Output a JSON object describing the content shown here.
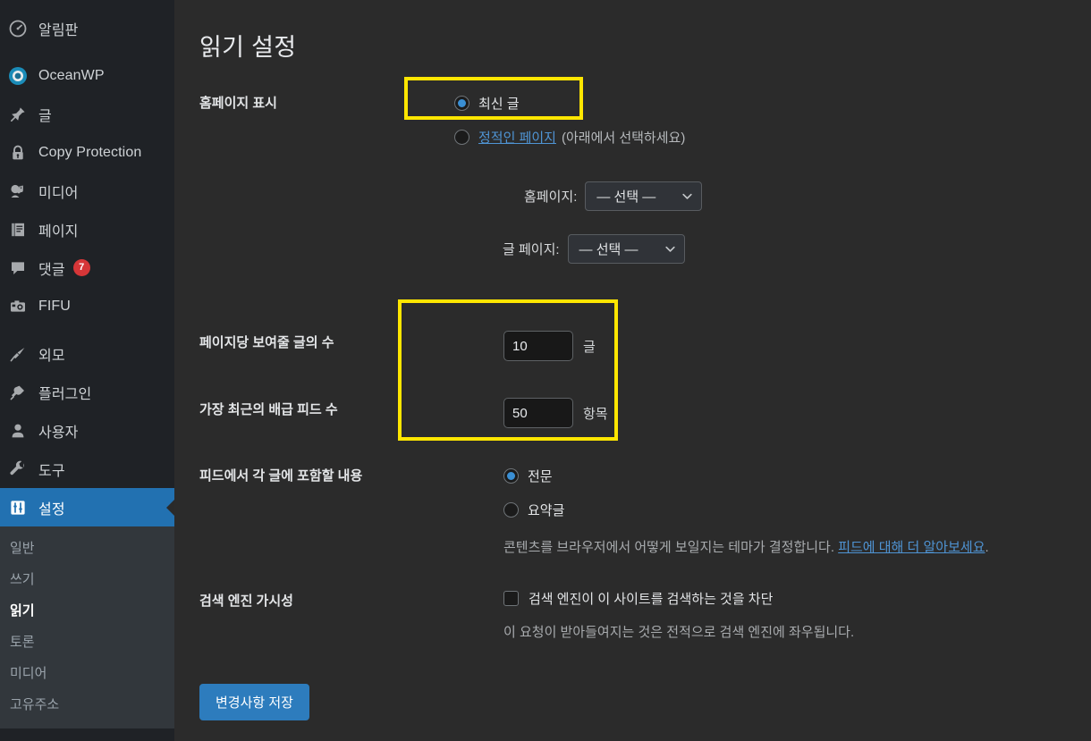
{
  "sidebar": {
    "items": [
      {
        "label": "알림판",
        "icon": "dashboard-icon",
        "active": false,
        "badge": null
      },
      {
        "label": "OceanWP",
        "icon": "oceanwp-icon",
        "active": false,
        "badge": null
      },
      {
        "label": "글",
        "icon": "pin-icon",
        "active": false,
        "badge": null
      },
      {
        "label": "Copy Protection",
        "icon": "lock-icon",
        "active": false,
        "badge": null
      },
      {
        "label": "미디어",
        "icon": "media-icon",
        "active": false,
        "badge": null
      },
      {
        "label": "페이지",
        "icon": "page-icon",
        "active": false,
        "badge": null
      },
      {
        "label": "댓글",
        "icon": "comment-icon",
        "active": false,
        "badge": "7"
      },
      {
        "label": "FIFU",
        "icon": "camera-icon",
        "active": false,
        "badge": null
      },
      {
        "label": "외모",
        "icon": "brush-icon",
        "active": false,
        "badge": null
      },
      {
        "label": "플러그인",
        "icon": "plugin-icon",
        "active": false,
        "badge": null
      },
      {
        "label": "사용자",
        "icon": "user-icon",
        "active": false,
        "badge": null
      },
      {
        "label": "도구",
        "icon": "wrench-icon",
        "active": false,
        "badge": null
      },
      {
        "label": "설정",
        "icon": "settings-icon",
        "active": true,
        "badge": null
      }
    ],
    "submenu": [
      {
        "label": "일반",
        "current": false
      },
      {
        "label": "쓰기",
        "current": false
      },
      {
        "label": "읽기",
        "current": true
      },
      {
        "label": "토론",
        "current": false
      },
      {
        "label": "미디어",
        "current": false
      },
      {
        "label": "고유주소",
        "current": false
      }
    ]
  },
  "page": {
    "title": "읽기 설정"
  },
  "homepage_display": {
    "label": "홈페이지 표시",
    "option_latest": "최신 글",
    "option_static_link": "정적인 페이지",
    "option_static_suffix": "(아래에서 선택하세요)",
    "homepage_label": "홈페이지:",
    "homepage_value": "— 선택 —",
    "posts_page_label": "글 페이지:",
    "posts_page_value": "— 선택 —"
  },
  "posts_per_page": {
    "label": "페이지당 보여줄 글의 수",
    "value": "10",
    "unit": "글"
  },
  "feed_items": {
    "label": "가장 최근의 배급 피드 수",
    "value": "50",
    "unit": "항목"
  },
  "feed_content": {
    "label": "피드에서 각 글에 포함할 내용",
    "option_full": "전문",
    "option_excerpt": "요약글",
    "help_text": "콘텐츠를 브라우저에서 어떻게 보일지는 테마가 결정합니다. ",
    "help_link": "피드에 대해 더 알아보세요",
    "help_period": "."
  },
  "search_visibility": {
    "label": "검색 엔진 가시성",
    "checkbox_label": "검색 엔진이 이 사이트를 검색하는 것을 차단",
    "help_text": "이 요청이 받아들여지는 것은 전적으로 검색 엔진에 좌우됩니다."
  },
  "save": {
    "label": "변경사항 저장"
  },
  "colors": {
    "accent": "#2271b1",
    "highlight": "#ffe600",
    "badge": "#d63638",
    "link": "#4f94d4"
  }
}
